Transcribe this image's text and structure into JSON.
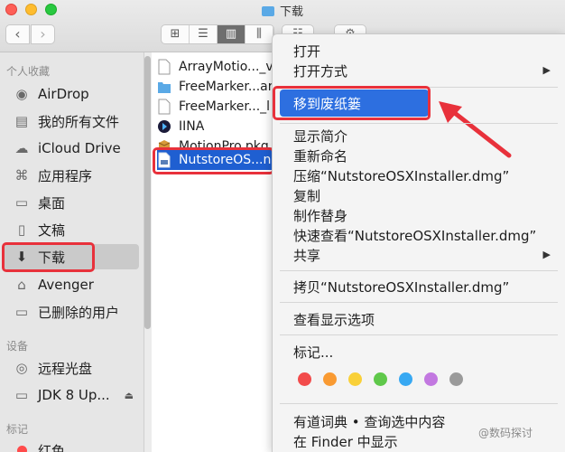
{
  "window": {
    "title": "下载"
  },
  "toolbar": {
    "back": "‹",
    "forward": "›",
    "view_buttons": [
      "⊞",
      "☰",
      "▥",
      "⫼"
    ],
    "group_btn": "☷",
    "gear_btn": "⚙",
    "share_btn": "⇪",
    "tag_btn": "◯"
  },
  "sidebar": {
    "favorites_label": "个人收藏",
    "devices_label": "设备",
    "tags_label": "标记",
    "items": [
      {
        "label": "AirDrop",
        "icon": "airdrop-icon",
        "glyph": "◉"
      },
      {
        "label": "我的所有文件",
        "icon": "all-files-icon",
        "glyph": "▤"
      },
      {
        "label": "iCloud Drive",
        "icon": "cloud-icon",
        "glyph": "☁"
      },
      {
        "label": "应用程序",
        "icon": "applications-icon",
        "glyph": "⌘"
      },
      {
        "label": "桌面",
        "icon": "desktop-icon",
        "glyph": "▭"
      },
      {
        "label": "文稿",
        "icon": "documents-icon",
        "glyph": "▯"
      },
      {
        "label": "下载",
        "icon": "downloads-icon",
        "glyph": "⬇"
      },
      {
        "label": "Avenger",
        "icon": "home-icon",
        "glyph": "⌂"
      },
      {
        "label": "已删除的用户",
        "icon": "folder-icon",
        "glyph": "▭"
      }
    ],
    "devices": [
      {
        "label": "远程光盘",
        "icon": "disc-icon",
        "glyph": "◎"
      },
      {
        "label": "JDK 8 Up...",
        "icon": "disk-icon",
        "glyph": "▭",
        "eject": "⏏"
      }
    ],
    "tags": [
      {
        "label": "红色",
        "color": "#ff4b4b"
      }
    ]
  },
  "files": [
    {
      "name": "ArrayMotio..._v",
      "icon": "document-icon",
      "color": "#ffffff"
    },
    {
      "name": "FreeMarker...ar",
      "icon": "folder-icon",
      "color": "#5aa9e6"
    },
    {
      "name": "FreeMarker..._l",
      "icon": "document-icon",
      "color": "#ffffff"
    },
    {
      "name": "IINA",
      "icon": "iina-app-icon",
      "color": "#1b1b3a"
    },
    {
      "name": "MotionPro.pkg",
      "icon": "package-icon",
      "color": "#c98a2e"
    },
    {
      "name": "NutstoreOS...n",
      "icon": "dmg-icon",
      "color": "#ffffff",
      "selected": true
    }
  ],
  "context_menu": {
    "open": "打开",
    "open_with": "打开方式",
    "move_to_trash": "移到废纸篓",
    "get_info": "显示简介",
    "rename": "重新命名",
    "compress": "压缩“NutstoreOSXInstaller.dmg”",
    "duplicate": "复制",
    "make_alias": "制作替身",
    "quick_look": "快速查看“NutstoreOSXInstaller.dmg”",
    "share": "共享",
    "copy_item": "拷贝“NutstoreOSXInstaller.dmg”",
    "view_options": "查看显示选项",
    "tags": "标记...",
    "submenu_arrow": "▶",
    "tag_colors": [
      "#f24b4b",
      "#f99a32",
      "#f9d038",
      "#5fc84a",
      "#37a8f2",
      "#c278e0",
      "#9a9a9a"
    ],
    "youdao": "有道词典 • 查询选中内容",
    "show_in_finder": "在 Finder 中显示"
  },
  "watermark": "@数码探讨",
  "accent": {
    "selection": "#1f5fd1",
    "highlight_box": "#e8313b",
    "menu_highlight": "#2d6fe0"
  }
}
